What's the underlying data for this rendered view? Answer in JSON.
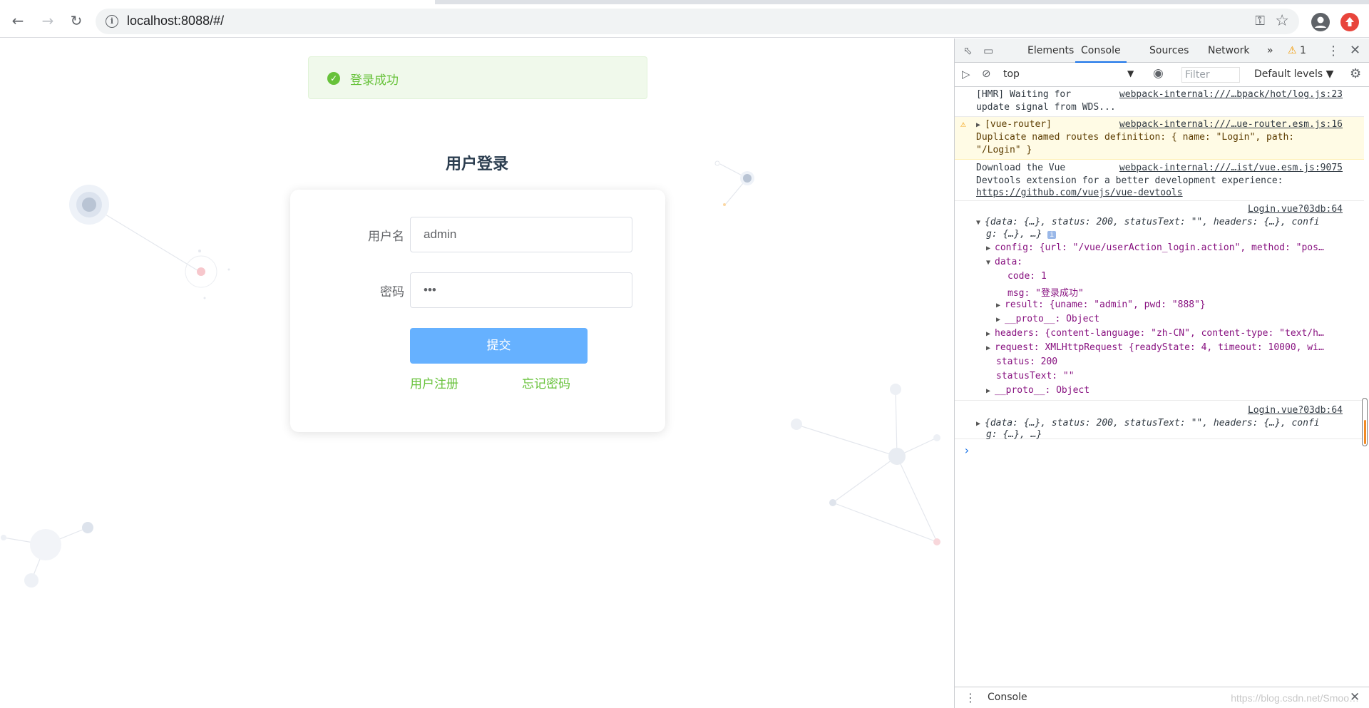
{
  "browser": {
    "url": "localhost:8088/#/"
  },
  "page": {
    "message": "登录成功",
    "title": "用户登录",
    "username_label": "用户名",
    "username_value": "admin",
    "password_label": "密码",
    "password_value": "•••",
    "submit_label": "提交",
    "register_link": "用户注册",
    "forgot_link": "忘记密码"
  },
  "devtools": {
    "tabs": [
      "Elements",
      "Console",
      "Sources",
      "Network"
    ],
    "more_tabs": "»",
    "warning_count": "1",
    "context": "top",
    "filter_placeholder": "Filter",
    "levels": "Default levels ▼",
    "bottom_tab": "Console",
    "entries": {
      "hmr_text1": "[HMR] Waiting for",
      "hmr_text2": "update signal from WDS...",
      "hmr_src": "webpack-internal:///…bpack/hot/log.js:23",
      "router_text1": "[vue-router]",
      "router_text2": "Duplicate named routes definition: { name: \"Login\", path:",
      "router_text3": "\"/Login\" }",
      "router_src": "webpack-internal:///…ue-router.esm.js:16",
      "vue_text1": "Download the Vue",
      "vue_text2": "Devtools extension for a better development experience:",
      "vue_link": "https://github.com/vuejs/vue-devtools",
      "vue_src": "webpack-internal:///…ist/vue.esm.js:9075",
      "login_src": "Login.vue?03db:64",
      "obj_line1": "{data: {…}, status: 200, statusText: \"\", headers: {…}, confi",
      "obj_line2": "g: {…}, …}",
      "config_line": "config: {url: \"/vue/userAction_login.action\", method: \"pos…",
      "data_line": "data:",
      "code_line": "code: 1",
      "msg_line": "msg: \"登录成功\"",
      "result_line": "result: {uname: \"admin\", pwd: \"888\"}",
      "proto_line": "__proto__: Object",
      "headers_line": "headers: {content-language: \"zh-CN\", content-type: \"text/h…",
      "request_line": "request: XMLHttpRequest {readyState: 4, timeout: 10000, wi…",
      "status_line": "status: 200",
      "statustext_line": "statusText: \"\"",
      "proto2_line": "__proto__: Object",
      "login_src2": "Login.vue?03db:64",
      "obj2_line1": "{data: {…}, status: 200, statusText: \"\", headers: {…}, confi",
      "obj2_line2": "g: {…}, …}",
      "prompt": "›"
    }
  },
  "watermark": "https://blog.csdn.net/Smoo…",
  "colors": {
    "success": "#67c23a",
    "primary_light": "#66b1ff",
    "chrome_bg": "#f1f3f4",
    "devtools_accent": "#1a73e8"
  }
}
